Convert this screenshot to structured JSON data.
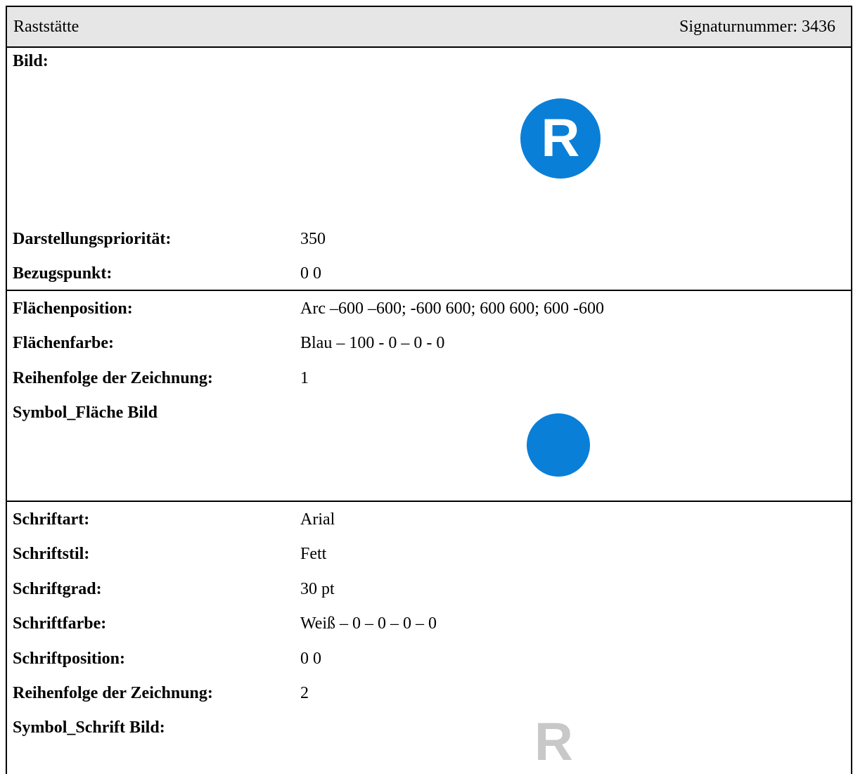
{
  "header": {
    "title": "Raststätte",
    "signature": "Signaturnummer: 3436"
  },
  "image_section": {
    "label": "Bild:",
    "symbol_letter": "R"
  },
  "general": [
    {
      "label": "Darstellungspriorität:",
      "value": "350"
    },
    {
      "label": "Bezugspunkt:",
      "value": "0 0"
    }
  ],
  "area": [
    {
      "label": "Flächenposition:",
      "value": "Arc –600 –600; -600 600; 600 600; 600 -600"
    },
    {
      "label": "Flächenfarbe:",
      "value": "Blau – 100 - 0 – 0 - 0"
    },
    {
      "label": "Reihenfolge der Zeichnung:",
      "value": "1"
    }
  ],
  "area_image_label": "Symbol_Fläche Bild",
  "font": [
    {
      "label": "Schriftart:",
      "value": "Arial"
    },
    {
      "label": "Schriftstil:",
      "value": "Fett"
    },
    {
      "label": "Schriftgrad:",
      "value": "30 pt"
    },
    {
      "label": "Schriftfarbe:",
      "value": "Weiß – 0 – 0 – 0 – 0"
    },
    {
      "label": "Schriftposition:",
      "value": "0 0"
    },
    {
      "label": "Reihenfolge der Zeichnung:",
      "value": "2"
    }
  ],
  "font_image": {
    "label": "Symbol_Schrift Bild:",
    "letter": "R"
  },
  "colors": {
    "symbol_blue": "#0a7fd8",
    "letter_white": "#ffffff",
    "preview_letter_gray": "#c8c8c8",
    "header_bg": "#e6e6e6"
  }
}
